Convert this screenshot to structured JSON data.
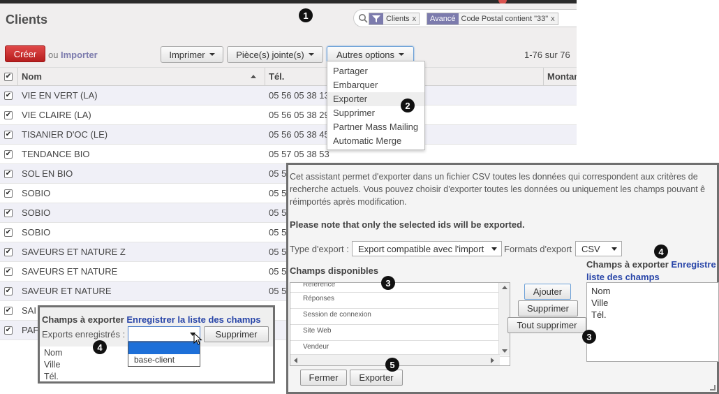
{
  "page": {
    "title": "Clients"
  },
  "search": {
    "facets": [
      {
        "tag_icon": "filter-icon",
        "value": "Clients",
        "remove": "x"
      },
      {
        "tag": "Avancé",
        "value": "Code Postal contient \"33\"",
        "remove": "x"
      }
    ]
  },
  "toolbar": {
    "create_label": "Créer",
    "or_label": "ou",
    "import_label": "Importer",
    "print_label": "Imprimer",
    "attachments_label": "Pièce(s) jointe(s)",
    "more_label": "Autres options",
    "pager": "1-76 sur 76"
  },
  "grid": {
    "columns": [
      "Nom",
      "Tél.",
      "Montan"
    ],
    "rows": [
      {
        "name": "VIE EN VERT (LA)",
        "tel": "05 56 05 38 13"
      },
      {
        "name": "VIE CLAIRE (LA)",
        "tel": "05 56 05 38 29"
      },
      {
        "name": "TISANIER D'OC (LE)",
        "tel": "05 56 05 38 45"
      },
      {
        "name": "TENDANCE BIO",
        "tel": "05 57 05 38 53"
      },
      {
        "name": "SOL EN BIO",
        "tel": "05 5"
      },
      {
        "name": "SOBIO",
        "tel": "05 5"
      },
      {
        "name": "SOBIO",
        "tel": "05 5"
      },
      {
        "name": "SOBIO",
        "tel": "05 5"
      },
      {
        "name": "SAVEURS ET NATURE Z",
        "tel": "05 5"
      },
      {
        "name": "SAVEURS ET NATURE",
        "tel": "05 5"
      },
      {
        "name": "SAVEUR ET NATURE",
        "tel": "05 5"
      },
      {
        "name": "SAI",
        "tel": ""
      },
      {
        "name": "PAF",
        "tel": ""
      }
    ]
  },
  "more_menu": {
    "items": [
      "Partager",
      "Embarquer",
      "Exporter",
      "Supprimer",
      "Partner Mass Mailing",
      "Automatic Merge"
    ],
    "highlighted": 2
  },
  "bullets": {
    "b1": "1",
    "b2": "2",
    "b3": "3",
    "b4": "4",
    "b5": "5"
  },
  "wizard": {
    "intro": "Cet assistant permet d'exporter dans un fichier CSV toutes les données qui correspondent aux critères de\nrecherche actuels. Vous pouvez choisir d'exporter toutes les données ou uniquement les champs pouvant ê\nréimportés après modification.",
    "note": "Please note that only the selected ids will be exported.",
    "export_type_label": "Type d'export :",
    "export_type_value": "Export compatible avec l'import",
    "format_label": "Formats d'export",
    "format_value": "CSV",
    "available_title": "Champs disponibles",
    "available_fields": [
      "Référence",
      "Réponses",
      "Session de connexion",
      "Site Web",
      "Vendeur"
    ],
    "add_label": "Ajouter",
    "remove_label": "Supprimer",
    "remove_all_label": "Tout supprimer",
    "export_fields_title": "Champs à exporter",
    "save_list_link_1": "Enregistre",
    "save_list_link_2": "liste des champs",
    "export_fields": [
      "Nom",
      "Ville",
      "Tél."
    ],
    "close_label": "Fermer",
    "export_label": "Exporter"
  },
  "popup": {
    "title": "Champs à exporter",
    "save_list_link": "Enregistrer la liste des champs",
    "saved_exports_label": "Exports enregistrés :",
    "delete_label": "Supprimer",
    "dropdown_options": [
      "",
      "base-client"
    ],
    "fields": [
      "Nom",
      "Ville",
      "Tél."
    ]
  },
  "colors": {
    "create_button": "#c62828",
    "facet_tag": "#7c7bad",
    "link": "#2845a8",
    "dropdown_selected": "#1d6fd8"
  }
}
